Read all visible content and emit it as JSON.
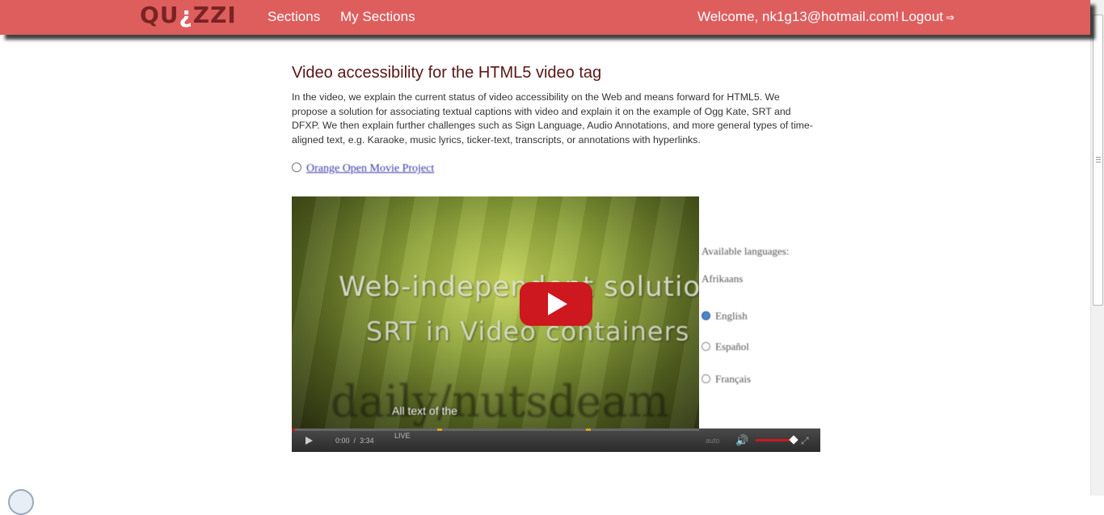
{
  "navbar": {
    "brand": {
      "part1": "QU",
      "qmark": "¿",
      "part2": "ZZI"
    },
    "links": [
      "Sections",
      "My Sections"
    ],
    "welcome": "Welcome, nk1g13@hotmail.com!",
    "logout": "Logout",
    "logout_icon": "sign-out-icon",
    "color": "#de5e5e"
  },
  "main": {
    "title": "Video accessibility for the HTML5 video tag",
    "description": "In the video, we explain the current status of video accessibility on the Web and means forward for HTML5. We propose a solution for associating textual captions with video and explain it on the example of Ogg Kate, SRT and DFXP. We then explain further challenges such as Sign Language, Audio Annotations, and more general types of time-aligned text, e.g. Karaoke, music lyrics, ticker-text, transcripts, or annotations with hyperlinks.",
    "video_link": "Orange Open Movie Project"
  },
  "video": {
    "overlay_line1": "Web-independent solutions",
    "overlay_line2": "SRT in Video containers",
    "overlay_line3": "daily/nutsdeam",
    "caption": "All text of the ",
    "languages_title": "Available languages:",
    "languages": [
      "Afrikaans",
      "English",
      "Español",
      "Français"
    ],
    "selected_language": "English",
    "play_icon": "play-icon",
    "controls": {
      "current_time": "0:00",
      "separator": "/",
      "duration": "3:34",
      "live": "LIVE",
      "quality": "auto",
      "volume_fraction": 0.9
    }
  }
}
